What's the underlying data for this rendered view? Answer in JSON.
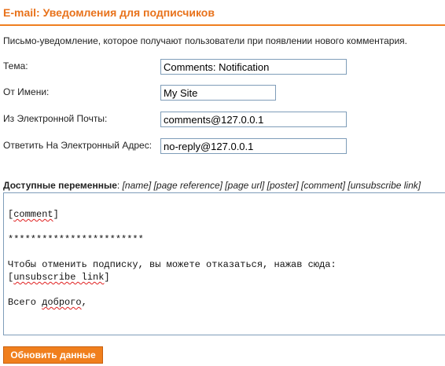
{
  "header": {
    "title": "E-mail: Уведомления для подписчиков",
    "description": "Письмо-уведомление, которое получают пользователи при появлении нового комментария."
  },
  "form": {
    "subject": {
      "label": "Тема:",
      "value": "Comments: Notification"
    },
    "from_name": {
      "label": "От Имени:",
      "value": "My Site"
    },
    "from_email": {
      "label": "Из Электронной Почты:",
      "value": "comments@127.0.0.1"
    },
    "reply_to": {
      "label": "Ответить На Электронный Адрес:",
      "value": "no-reply@127.0.0.1"
    }
  },
  "variables": {
    "heading": "Доступные переменные",
    "separator": ": ",
    "list": "[name] [page reference] [page url] [poster] [comment] [unsubscribe link]"
  },
  "body": {
    "comment_token": "comment",
    "stars": "************************",
    "unsubscribe_text": "Чтобы отменить подписку, вы можете отказаться, нажав сюда:",
    "unsubscribe_token": "unsubscribe link",
    "closing_before": "Всего ",
    "closing_word": "доброго",
    "closing_after": ","
  },
  "actions": {
    "update_label": "Обновить данные"
  },
  "colors": {
    "accent": "#ef7f1f",
    "title": "#e8721b",
    "input_border": "#7f9db9",
    "spellcheck": "#e02020"
  }
}
